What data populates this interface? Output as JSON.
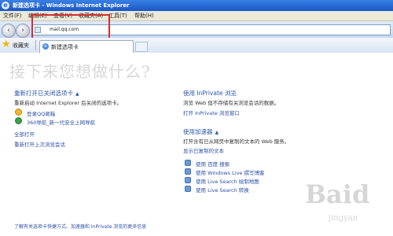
{
  "window": {
    "title": "新建选项卡 - Windows Internet Explorer"
  },
  "menu": [
    "文件(F)",
    "编辑(E)",
    "查看(V)",
    "收藏夹(A)",
    "工具(T)",
    "帮助(H)"
  ],
  "address": {
    "url": "mail.qq.com"
  },
  "tabs": {
    "favorites_label": "收藏夹",
    "active_tab": "新建选项卡"
  },
  "content": {
    "headline": "接下来您想做什么?",
    "reopen": {
      "title": "重新打开已关闭选项卡",
      "desc": "重新启动 Internet Explorer 后关闭的选项卡。",
      "items": [
        "登录QQ邮箱",
        "360导航_新一代安全上网导航"
      ],
      "open_all": "全部打开",
      "reopen_last": "重新打开上次浏览会话"
    },
    "inprivate": {
      "title": "使用 InPrivate 浏览",
      "desc": "浏览 Web 但不存储有关浏览会话的数据。",
      "link": "打开 InPrivate 浏览窗口"
    },
    "accelerators": {
      "title": "使用加速器",
      "desc": "打开含有已从网页中复制的文本的 Web 服务。",
      "show_copied": "显示已复制的文本",
      "items": [
        "使用 百度 搜索",
        "使用 Windows Live 撰写博客",
        "使用 Live Search 绘制地图",
        "使用 Live Search 转换"
      ]
    },
    "footer": "了解有关选项卡快捷方式、加速器和 InPrivate 浏览的更多信息"
  },
  "watermark": {
    "big": "Baid",
    "small": "jingyan"
  },
  "colors": {
    "titlebar": "#1f5fd1",
    "link": "#2c4fa6",
    "highlight": "#d0302f"
  }
}
